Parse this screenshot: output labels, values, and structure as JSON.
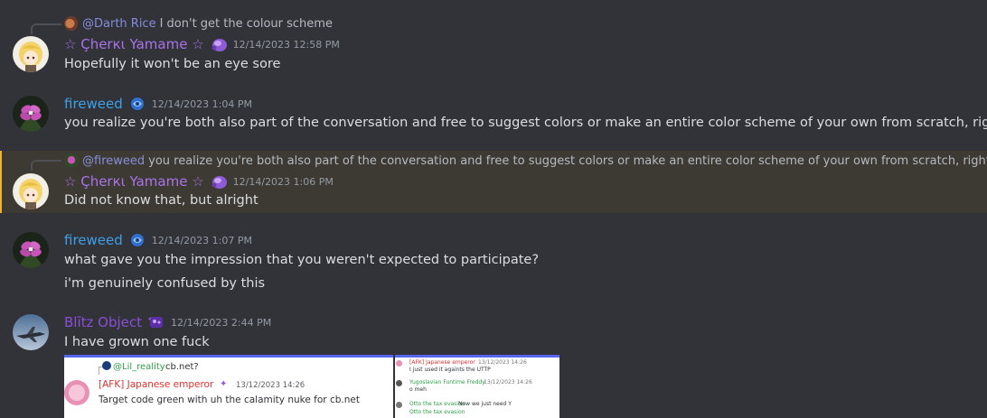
{
  "messages": [
    {
      "reply": {
        "mention": "@Darth Rice",
        "text": "I don't get the colour scheme"
      },
      "username": "☆ Çhеrкι Yamame ☆",
      "timestamp": "12/14/2023 12:58 PM",
      "lines": [
        "Hopefully it won't be an eye sore"
      ]
    },
    {
      "username": "fireweed",
      "timestamp": "12/14/2023 1:04 PM",
      "lines": [
        "you realize you're both also part of the conversation and free to suggest colors or make an entire color scheme of your own from scratch, right?"
      ]
    },
    {
      "reply": {
        "mention": "@fireweed",
        "text": "you realize you're both also part of the conversation and free to suggest colors or make an entire color scheme of your own from scratch, right?"
      },
      "username": "☆ Çhеrкι Yamame ☆",
      "timestamp": "12/14/2023 1:06 PM",
      "lines": [
        "Did not know that, but alright"
      ]
    },
    {
      "username": "fireweed",
      "timestamp": "12/14/2023 1:07 PM",
      "lines": [
        "what gave you the impression that you weren't expected to participate?",
        "i'm genuinely confused by this"
      ]
    },
    {
      "username": "Blītz Object",
      "timestamp": "12/14/2023 2:44 PM",
      "lines": [
        "I have grown one fuck"
      ]
    }
  ],
  "embed": {
    "reply_mention": "@Lil_reality",
    "reply_text": "cb.net?",
    "username": "[AFK] Japanese emperor",
    "timestamp": "13/12/2023 14:26",
    "text": "Target code green with uh the calamity nuke for cb.net",
    "right": {
      "line1_user": "[AFK] Japanese emperor",
      "line1_time": "13/12/2023 14:26",
      "line1_text": "I just used it againts the UTTP",
      "line2_user": "Yugoslavian Funtime Freddy",
      "line2_time": "13/12/2023 14:26",
      "line2_text": "o meh",
      "line3_user": "Otto the tax evasion",
      "line3_text": "Now we just need Y",
      "line4_user": "Otto the tax evasion"
    }
  },
  "colors": {
    "background": "#313338",
    "highlight": "#3d3a33",
    "cherki": "#a974e8",
    "fireweed": "#3ea0e8",
    "blitz": "#8a4fd6",
    "mention": "#949cf7",
    "afk_red": "#e03131",
    "green_user": "#2f9e44"
  }
}
